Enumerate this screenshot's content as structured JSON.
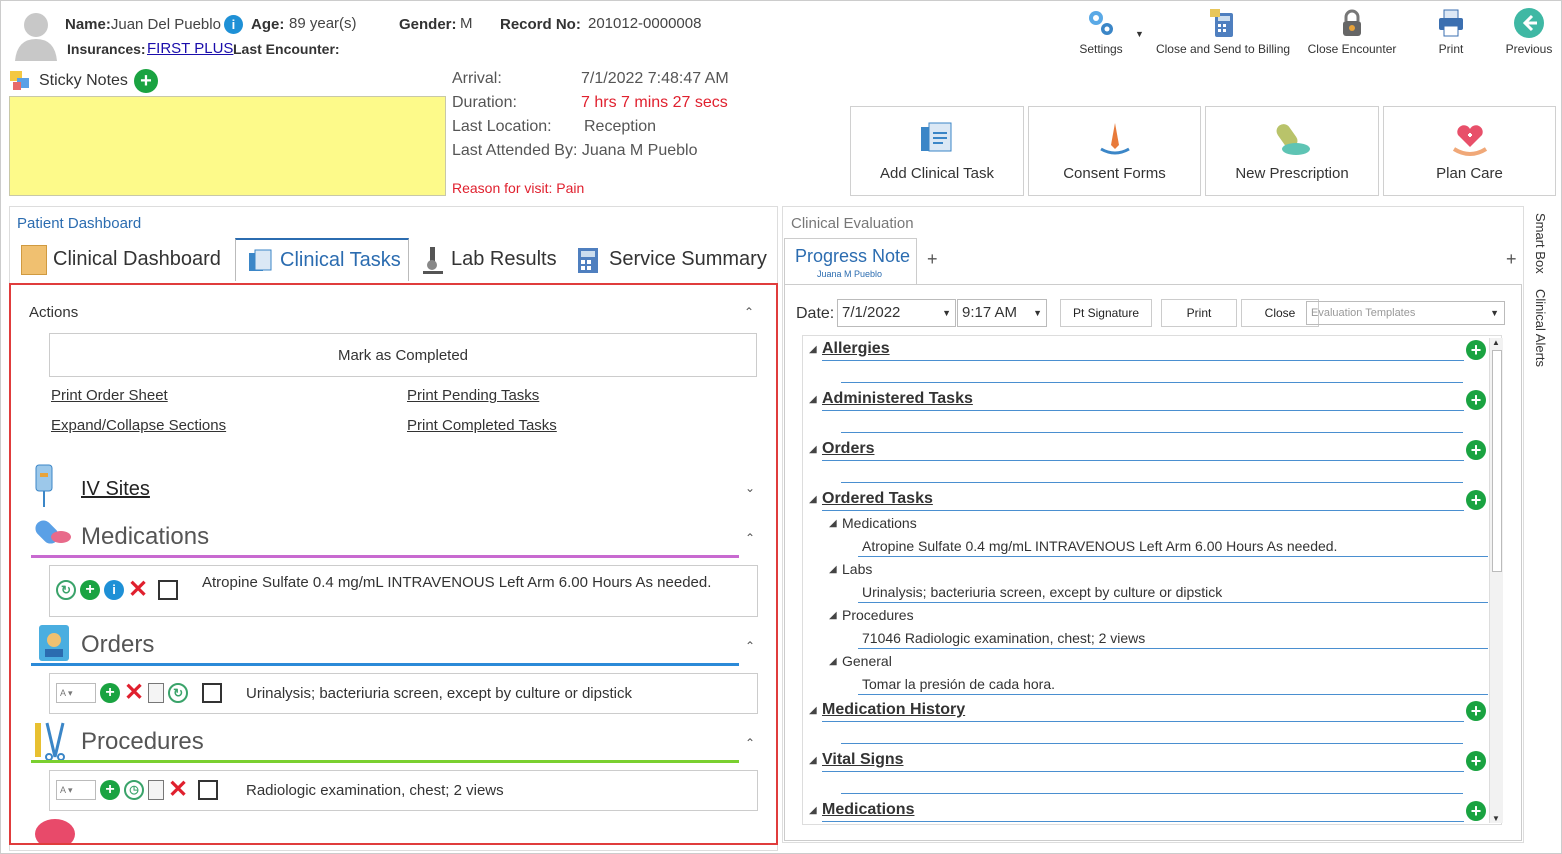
{
  "patient": {
    "name_label": "Name:",
    "name": "Juan Del Pueblo",
    "age_label": "Age:",
    "age": "89 year(s)",
    "gender_label": "Gender:",
    "gender": "M",
    "record_label": "Record No:",
    "record": "201012-0000008",
    "insurances_label": "Insurances:",
    "insurance": "FIRST PLUS",
    "last_encounter_label": "Last Encounter:"
  },
  "toolbar": {
    "settings": "Settings",
    "close_send_billing": "Close and Send to Billing",
    "close_encounter": "Close Encounter",
    "print": "Print",
    "previous": "Previous"
  },
  "sticky": {
    "label": "Sticky Notes"
  },
  "visit": {
    "arrival_label": "Arrival:",
    "arrival": "7/1/2022 7:48:47 AM",
    "duration_label": "Duration:",
    "duration": "7 hrs 7 mins 27 secs",
    "last_location_label": "Last Location:",
    "last_location": "Reception",
    "last_attended": "Last Attended By: Juana M Pueblo",
    "reason": "Reason for visit: Pain"
  },
  "quick_actions": {
    "add_clinical_task": "Add Clinical Task",
    "consent_forms": "Consent Forms",
    "new_prescription": "New Prescription",
    "plan_care": "Plan Care"
  },
  "dashboard": {
    "title": "Patient Dashboard",
    "tabs": [
      "Clinical Dashboard",
      "Clinical Tasks",
      "Lab Results",
      "Service Summary"
    ],
    "actions_title": "Actions",
    "mark_completed": "Mark as Completed",
    "print_order_sheet": "Print Order Sheet",
    "print_pending": "Print Pending Tasks",
    "expand_collapse": "Expand/Collapse Sections",
    "print_completed": "Print Completed Tasks",
    "iv_sites": "IV Sites",
    "medications": "Medications",
    "med_item": "Atropine Sulfate 0.4 mg/mL INTRAVENOUS Left Arm 6.00 Hours  As needed.",
    "orders": "Orders",
    "order_item": "Urinalysis; bacteriuria screen, except by culture or dipstick",
    "procedures": "Procedures",
    "procedure_item": "Radiologic examination, chest; 2 views"
  },
  "evaluation": {
    "title": "Clinical Evaluation",
    "tab": "Progress Note",
    "tab_sub": "Juana M Pueblo",
    "date_label": "Date:",
    "date": "7/1/2022",
    "time": "9:17 AM",
    "pt_signature": "Pt Signature",
    "print": "Print",
    "close": "Close",
    "templates_placeholder": "Evaluation Templates",
    "sections": [
      "Allergies",
      "Administered Tasks",
      "Orders",
      "Ordered Tasks",
      "Medication History",
      "Vital Signs",
      "Medications"
    ],
    "ordered": {
      "medications_label": "Medications",
      "medications_item": "Atropine Sulfate 0.4 mg/mL INTRAVENOUS Left Arm 6.00 Hours  As needed.",
      "labs_label": "Labs",
      "labs_item": "Urinalysis; bacteriuria screen, except by culture or dipstick",
      "procedures_label": "Procedures",
      "procedures_item": "71046 Radiologic examination, chest; 2 views",
      "general_label": "General",
      "general_item": "Tomar la presión de cada hora."
    }
  },
  "side": {
    "smart_box": "Smart Box",
    "clinical_alerts": "Clinical Alerts"
  }
}
